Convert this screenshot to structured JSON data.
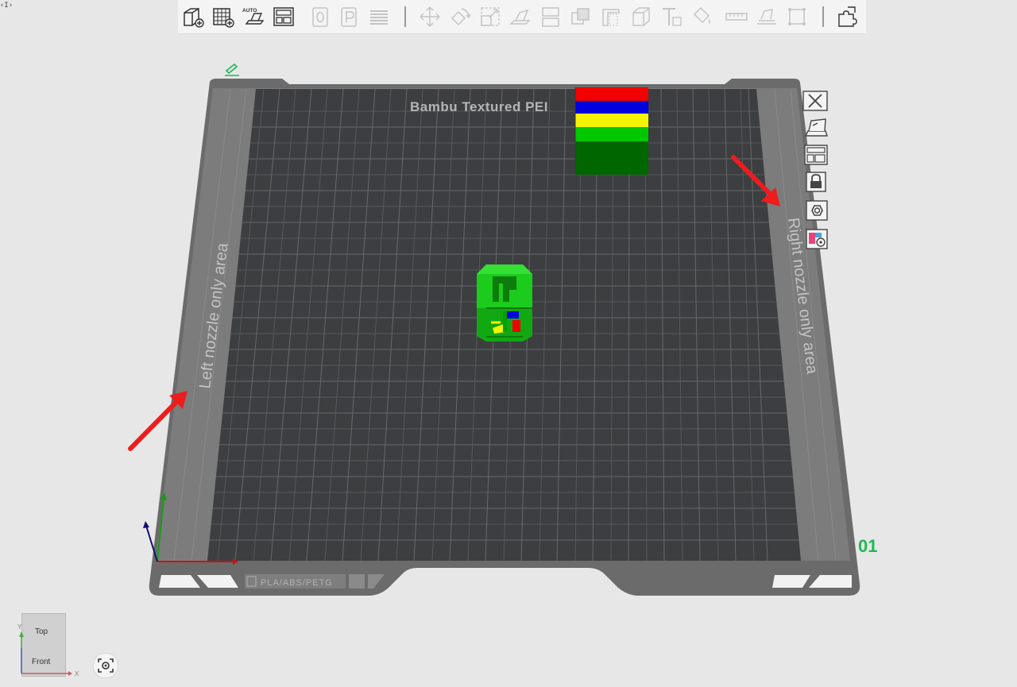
{
  "toolbar": {
    "corner_toggle": "‹I›",
    "buttons": [
      {
        "name": "add-object-button",
        "icon": "cube-plus-icon",
        "enabled": true
      },
      {
        "name": "add-plate-button",
        "icon": "grid-plus-icon",
        "enabled": true
      },
      {
        "name": "auto-orient-button",
        "icon": "auto-orient-icon",
        "label": "AUTO",
        "enabled": true
      },
      {
        "name": "arrange-button",
        "icon": "arrange-icon",
        "enabled": true
      },
      {
        "name": "plate-zero-button",
        "icon": "plate-0-icon",
        "enabled": false
      },
      {
        "name": "plate-p-button",
        "icon": "plate-p-icon",
        "enabled": false
      },
      {
        "name": "split-layers-button",
        "icon": "layers-icon",
        "enabled": false
      },
      {
        "name": "move-button",
        "icon": "move-icon",
        "enabled": false
      },
      {
        "name": "rotate-button",
        "icon": "rotate-icon",
        "enabled": false
      },
      {
        "name": "scale-button",
        "icon": "scale-icon",
        "enabled": false
      },
      {
        "name": "lay-on-face-button",
        "icon": "lay-on-face-icon",
        "enabled": false
      },
      {
        "name": "cut-button",
        "icon": "cut-icon",
        "enabled": false
      },
      {
        "name": "boolean-button",
        "icon": "boolean-icon",
        "enabled": false
      },
      {
        "name": "support-paint-button",
        "icon": "support-paint-icon",
        "enabled": false
      },
      {
        "name": "seam-paint-button",
        "icon": "seam-paint-icon",
        "enabled": false
      },
      {
        "name": "text-button",
        "icon": "text-icon",
        "enabled": false
      },
      {
        "name": "color-paint-button",
        "icon": "paint-bucket-icon",
        "enabled": false
      },
      {
        "name": "measure-button",
        "icon": "ruler-icon",
        "enabled": false
      },
      {
        "name": "assembly-button",
        "icon": "assembly-icon",
        "enabled": false
      },
      {
        "name": "fit-view-button",
        "icon": "fit-view-icon",
        "enabled": false
      },
      {
        "name": "variable-layer-button",
        "icon": "puzzle-icon",
        "enabled": true
      }
    ]
  },
  "plate": {
    "bed_label": "Bambu Textured PEI",
    "left_zone_label": "Left nozzle only area",
    "right_zone_label": "Right nozzle only area",
    "filament_tag": "PLA/ABS/PETG",
    "plate_number": "01"
  },
  "side_toolbar": [
    {
      "name": "delete-plate-button",
      "icon": "close-icon"
    },
    {
      "name": "arrange-plate-button",
      "icon": "arrange-plate-icon"
    },
    {
      "name": "orient-plate-button",
      "icon": "layout-icon"
    },
    {
      "name": "lock-plate-button",
      "icon": "lock-icon"
    },
    {
      "name": "plate-settings-button",
      "icon": "hex-nut-icon"
    },
    {
      "name": "filament-map-button",
      "icon": "filament-map-icon"
    }
  ],
  "view_cube": {
    "top_label": "Top",
    "front_label": "Front",
    "y_axis": "Y",
    "x_axis": "X"
  },
  "colors": {
    "accent_green": "#1db954",
    "plate_dark": "#3d3e40",
    "plate_frame": "#6a6a6a",
    "arrow_red": "#ee1c1c",
    "tower_red": "#f20000",
    "tower_blue": "#0000dc",
    "tower_yellow": "#f4f400",
    "tower_green": "#00c800",
    "tower_dark_green": "#006600",
    "model_green": "#1dcb1d"
  }
}
